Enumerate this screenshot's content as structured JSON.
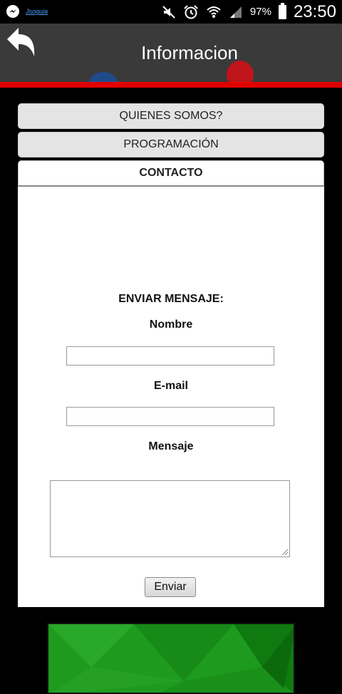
{
  "status_bar": {
    "left_app_label": "Jsoguia",
    "battery_percent": "97%",
    "time": "23:50",
    "icons": [
      "messenger-icon",
      "mute-icon",
      "alarm-icon",
      "wifi-icon",
      "signal-icon",
      "battery-icon"
    ]
  },
  "header": {
    "title": "Informacion",
    "accent_color": "#e00000"
  },
  "accordion": {
    "tabs": [
      {
        "label": "QUIENES SOMOS?",
        "active": false
      },
      {
        "label": "PROGRAMACIÓN",
        "active": false
      },
      {
        "label": "CONTACTO",
        "active": true
      }
    ]
  },
  "contact_form": {
    "title": "ENVIAR MENSAJE:",
    "name_label": "Nombre",
    "name_value": "",
    "email_label": "E-mail",
    "email_value": "",
    "message_label": "Mensaje",
    "message_value": "",
    "submit_label": "Enviar"
  },
  "colors": {
    "banner": "#1e9b1e",
    "header_bg": "#3a3a3a"
  }
}
